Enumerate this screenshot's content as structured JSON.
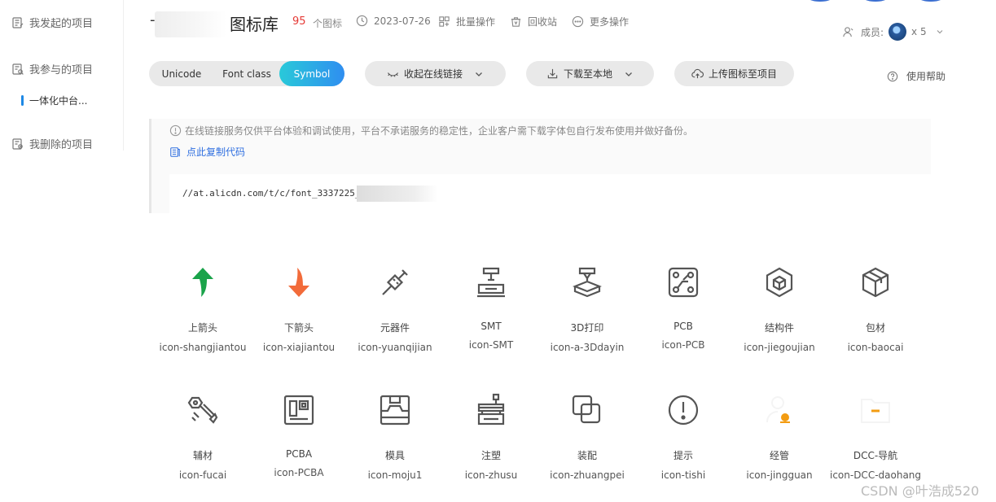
{
  "sidebar": {
    "items": [
      {
        "label": "我发起的项目"
      },
      {
        "label": "我参与的项目"
      },
      {
        "label": "一体化中台..."
      },
      {
        "label": "我删除的项目"
      }
    ]
  },
  "header": {
    "title": "图标库",
    "dash": "-",
    "icon_count": "95",
    "icon_count_label": "个图标",
    "date": "2023-07-26",
    "batch": "批量操作",
    "recycle": "回收站",
    "more": "更多操作",
    "members_label": "成员:",
    "members_count": "x 5"
  },
  "tabs": [
    "Unicode",
    "Font class",
    "Symbol"
  ],
  "toolbar": {
    "collapse_link": "收起在线链接",
    "download": "下载至本地",
    "upload": "上传图标至项目",
    "help": "使用帮助"
  },
  "notice": {
    "text": "在线链接服务仅供平台体验和调试使用，平台不承诺服务的稳定性，企业客户需下载字体包自行发布使用并做好备份。",
    "copy": "点此复制代码",
    "code": "//at.alicdn.com/t/c/font_3337225_"
  },
  "icons": [
    {
      "name": "上箭头",
      "code": "icon-shangjiantou",
      "icon": "arrow-up-icon",
      "color": "#1aa34a"
    },
    {
      "name": "下箭头",
      "code": "icon-xiajiantou",
      "icon": "arrow-down-icon",
      "color": "#f26b3a"
    },
    {
      "name": "元器件",
      "code": "icon-yuanqijian",
      "icon": "component-icon",
      "color": "#555555"
    },
    {
      "name": "SMT",
      "code": "icon-SMT",
      "icon": "smt-icon",
      "color": "#555555"
    },
    {
      "name": "3D打印",
      "code": "icon-a-3Ddayin",
      "icon": "3d-print-icon",
      "color": "#555555"
    },
    {
      "name": "PCB",
      "code": "icon-PCB",
      "icon": "pcb-icon",
      "color": "#555555"
    },
    {
      "name": "结构件",
      "code": "icon-jiegoujian",
      "icon": "structure-icon",
      "color": "#555555"
    },
    {
      "name": "包材",
      "code": "icon-baocai",
      "icon": "package-icon",
      "color": "#555555"
    },
    {
      "name": "辅材",
      "code": "icon-fucai",
      "icon": "bolt-icon",
      "color": "#555555"
    },
    {
      "name": "PCBA",
      "code": "icon-PCBA",
      "icon": "pcba-icon",
      "color": "#555555"
    },
    {
      "name": "模具",
      "code": "icon-moju1",
      "icon": "mold-icon",
      "color": "#555555"
    },
    {
      "name": "注塑",
      "code": "icon-zhusu",
      "icon": "injection-icon",
      "color": "#555555"
    },
    {
      "name": "装配",
      "code": "icon-zhuangpei",
      "icon": "assembly-icon",
      "color": "#555555"
    },
    {
      "name": "提示",
      "code": "icon-tishi",
      "icon": "alert-icon",
      "color": "#555555"
    },
    {
      "name": "经管",
      "code": "icon-jingguan",
      "icon": "manager-icon",
      "color": "#f39c12"
    },
    {
      "name": "DCC-导航",
      "code": "icon-DCC-daohang",
      "icon": "folder-icon",
      "color": "#f39c12"
    }
  ],
  "watermark": "CSDN @叶浩成520"
}
